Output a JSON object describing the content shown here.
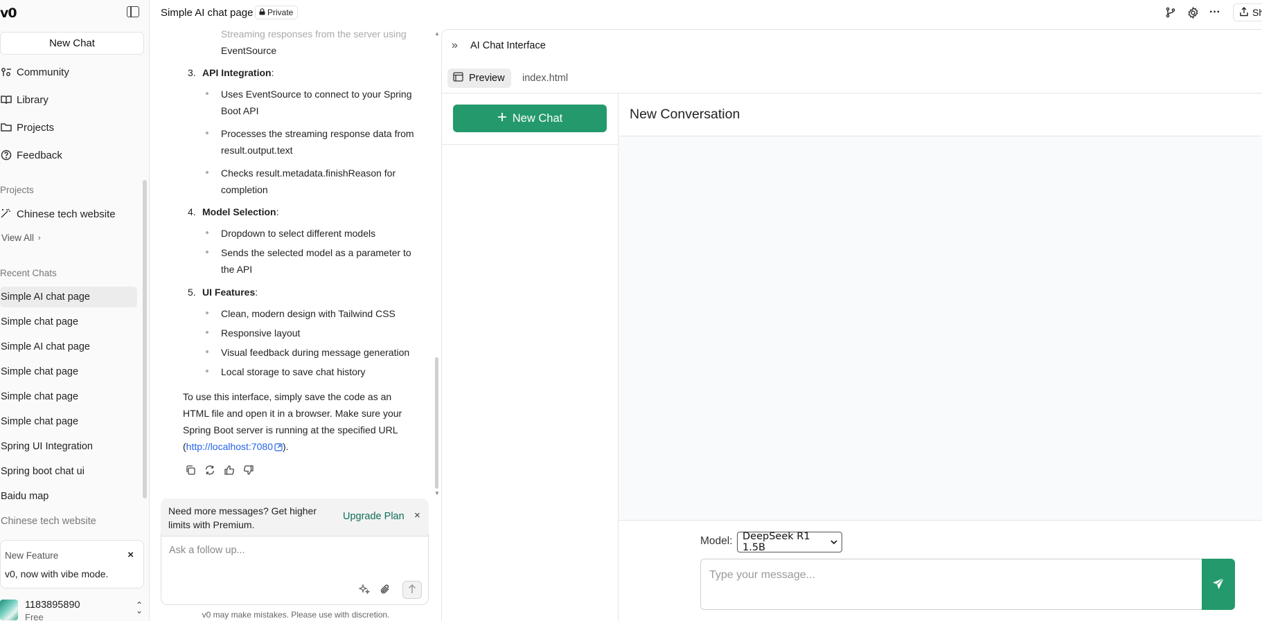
{
  "sidebar": {
    "logo": "v0",
    "new_chat": "New Chat",
    "nav": [
      {
        "label": "Community",
        "icon": "community-icon"
      },
      {
        "label": "Library",
        "icon": "book-icon"
      },
      {
        "label": "Projects",
        "icon": "folder-icon"
      },
      {
        "label": "Feedback",
        "icon": "help-circle-icon"
      }
    ],
    "projects_label": "Projects",
    "project_item": "Chinese tech website",
    "view_all": "View All",
    "recent_label": "Recent Chats",
    "recent": [
      "Simple AI chat page",
      "Simple chat page",
      "Simple AI chat page",
      "Simple chat page",
      "Simple chat page",
      "Simple chat page",
      "Spring UI Integration",
      "Spring boot chat ui",
      "Baidu map",
      "Chinese tech website"
    ],
    "feature": {
      "title": "New Feature",
      "text": "v0, now with vibe mode.",
      "close": "×"
    },
    "user": {
      "name": "1183895890",
      "plan": "Free"
    }
  },
  "topbar": {
    "title": "Simple AI chat page",
    "badge": "Private",
    "share": "Sh"
  },
  "chat": {
    "lines": {
      "faded_top": "Streaming responses from the server using",
      "faded_top2": "EventSource",
      "n3": "3.",
      "h3": "API Integration",
      "b3_1a": "Uses EventSource to connect to your Spring",
      "b3_1b": "Boot API",
      "b3_2a": "Processes the streaming response data from",
      "b3_2b": "result.output.text",
      "b3_3a": "Checks result.metadata.finishReason for",
      "b3_3b": "completion",
      "n4": "4.",
      "h4": "Model Selection",
      "b4_1": "Dropdown to select different models",
      "b4_2a": "Sends the selected model as a parameter to",
      "b4_2b": "the API",
      "n5": "5.",
      "h5": "UI Features",
      "b5_1": "Clean, modern design with Tailwind CSS",
      "b5_2": "Responsive layout",
      "b5_3": "Visual feedback during message generation",
      "b5_4": "Local storage to save chat history",
      "p1": "To use this interface, simply save the code as an",
      "p2": "HTML file and open it in a browser. Make sure your",
      "p3": "Spring Boot server is running at the specified URL",
      "p4_open": "(",
      "p4_link": "http://localhost:7080",
      "p4_close": ").",
      "colon": ":"
    },
    "upgrade": {
      "text": "Need more messages? Get higher limits with Premium.",
      "link": "Upgrade Plan",
      "close": "×"
    },
    "follow_placeholder": "Ask a follow up...",
    "disclaimer": "v0 may make mistakes. Please use with discretion."
  },
  "preview": {
    "title": "AI Chat Interface",
    "tab_preview": "Preview",
    "tab_file": "index.html",
    "app": {
      "new_chat": "New Chat",
      "conversation_title": "New Conversation",
      "model_label": "Model:",
      "model_selected": "DeepSeek R1 1.5B",
      "message_placeholder": "Type your message...",
      "accent": "#249a6c"
    }
  }
}
